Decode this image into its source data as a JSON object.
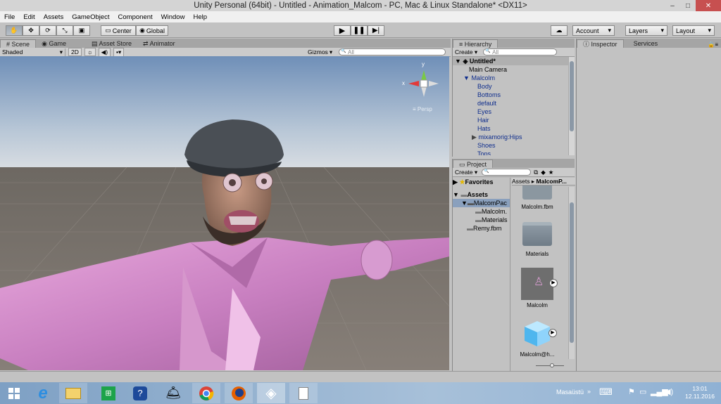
{
  "window": {
    "title": "Unity Personal (64bit) - Untitled - Animation_Malcom - PC, Mac & Linux Standalone* <DX11>",
    "min": "–",
    "max": "□",
    "close": "✕"
  },
  "menu": [
    "File",
    "Edit",
    "Assets",
    "GameObject",
    "Component",
    "Window",
    "Help"
  ],
  "toolbar": {
    "center": "Center",
    "global": "Global",
    "account": "Account",
    "layers": "Layers",
    "layout": "Layout"
  },
  "scene_tabs": {
    "scene": "Scene",
    "game": "Game",
    "asset_store": "Asset Store",
    "animator": "Animator"
  },
  "scene_bar": {
    "shading": "Shaded",
    "mode_2d": "2D",
    "gizmos": "Gizmos",
    "search_placeholder": "All"
  },
  "gizmo": {
    "x": "x",
    "y": "y",
    "persp": "Persp"
  },
  "hierarchy": {
    "tab": "Hierarchy",
    "create": "Create",
    "search_placeholder": "All",
    "scene": "Untitled*",
    "items": [
      "Main Camera",
      "Malcolm",
      "Body",
      "Bottoms",
      "default",
      "Eyes",
      "Hair",
      "Hats",
      "mixamorig:Hips",
      "Shoes",
      "Tops"
    ]
  },
  "project": {
    "tab": "Project",
    "create": "Create",
    "favorites": "Favorites",
    "assets": "Assets",
    "tree": [
      "MalcomPac",
      "Malcolm.",
      "Materials",
      "Remy.fbm"
    ],
    "breadcrumb": [
      "Assets",
      "MalcomP..."
    ],
    "items": [
      "Malcolm.fbm",
      "Materials",
      "Malcolm",
      "Malcolm@h..."
    ]
  },
  "inspector": {
    "tab": "Inspector",
    "services_tab": "Services"
  },
  "taskbar": {
    "language": "Masaüstü",
    "time": "13:01",
    "date": "12.11.2016"
  },
  "colors": {
    "unity_bg": "#c2c2c2",
    "selection": "#8aa0bd",
    "close_button": "#c75050"
  }
}
